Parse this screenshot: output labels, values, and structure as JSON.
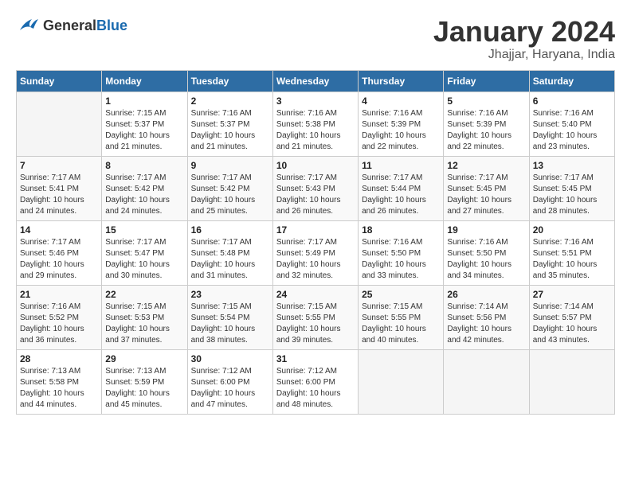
{
  "header": {
    "logo_general": "General",
    "logo_blue": "Blue",
    "title": "January 2024",
    "subtitle": "Jhajjar, Haryana, India"
  },
  "days_of_week": [
    "Sunday",
    "Monday",
    "Tuesday",
    "Wednesday",
    "Thursday",
    "Friday",
    "Saturday"
  ],
  "weeks": [
    [
      {
        "day": "",
        "sunrise": "",
        "sunset": "",
        "daylight": ""
      },
      {
        "day": "1",
        "sunrise": "Sunrise: 7:15 AM",
        "sunset": "Sunset: 5:37 PM",
        "daylight": "Daylight: 10 hours and 21 minutes."
      },
      {
        "day": "2",
        "sunrise": "Sunrise: 7:16 AM",
        "sunset": "Sunset: 5:37 PM",
        "daylight": "Daylight: 10 hours and 21 minutes."
      },
      {
        "day": "3",
        "sunrise": "Sunrise: 7:16 AM",
        "sunset": "Sunset: 5:38 PM",
        "daylight": "Daylight: 10 hours and 21 minutes."
      },
      {
        "day": "4",
        "sunrise": "Sunrise: 7:16 AM",
        "sunset": "Sunset: 5:39 PM",
        "daylight": "Daylight: 10 hours and 22 minutes."
      },
      {
        "day": "5",
        "sunrise": "Sunrise: 7:16 AM",
        "sunset": "Sunset: 5:39 PM",
        "daylight": "Daylight: 10 hours and 22 minutes."
      },
      {
        "day": "6",
        "sunrise": "Sunrise: 7:16 AM",
        "sunset": "Sunset: 5:40 PM",
        "daylight": "Daylight: 10 hours and 23 minutes."
      }
    ],
    [
      {
        "day": "7",
        "sunrise": "Sunrise: 7:17 AM",
        "sunset": "Sunset: 5:41 PM",
        "daylight": "Daylight: 10 hours and 24 minutes."
      },
      {
        "day": "8",
        "sunrise": "Sunrise: 7:17 AM",
        "sunset": "Sunset: 5:42 PM",
        "daylight": "Daylight: 10 hours and 24 minutes."
      },
      {
        "day": "9",
        "sunrise": "Sunrise: 7:17 AM",
        "sunset": "Sunset: 5:42 PM",
        "daylight": "Daylight: 10 hours and 25 minutes."
      },
      {
        "day": "10",
        "sunrise": "Sunrise: 7:17 AM",
        "sunset": "Sunset: 5:43 PM",
        "daylight": "Daylight: 10 hours and 26 minutes."
      },
      {
        "day": "11",
        "sunrise": "Sunrise: 7:17 AM",
        "sunset": "Sunset: 5:44 PM",
        "daylight": "Daylight: 10 hours and 26 minutes."
      },
      {
        "day": "12",
        "sunrise": "Sunrise: 7:17 AM",
        "sunset": "Sunset: 5:45 PM",
        "daylight": "Daylight: 10 hours and 27 minutes."
      },
      {
        "day": "13",
        "sunrise": "Sunrise: 7:17 AM",
        "sunset": "Sunset: 5:45 PM",
        "daylight": "Daylight: 10 hours and 28 minutes."
      }
    ],
    [
      {
        "day": "14",
        "sunrise": "Sunrise: 7:17 AM",
        "sunset": "Sunset: 5:46 PM",
        "daylight": "Daylight: 10 hours and 29 minutes."
      },
      {
        "day": "15",
        "sunrise": "Sunrise: 7:17 AM",
        "sunset": "Sunset: 5:47 PM",
        "daylight": "Daylight: 10 hours and 30 minutes."
      },
      {
        "day": "16",
        "sunrise": "Sunrise: 7:17 AM",
        "sunset": "Sunset: 5:48 PM",
        "daylight": "Daylight: 10 hours and 31 minutes."
      },
      {
        "day": "17",
        "sunrise": "Sunrise: 7:17 AM",
        "sunset": "Sunset: 5:49 PM",
        "daylight": "Daylight: 10 hours and 32 minutes."
      },
      {
        "day": "18",
        "sunrise": "Sunrise: 7:16 AM",
        "sunset": "Sunset: 5:50 PM",
        "daylight": "Daylight: 10 hours and 33 minutes."
      },
      {
        "day": "19",
        "sunrise": "Sunrise: 7:16 AM",
        "sunset": "Sunset: 5:50 PM",
        "daylight": "Daylight: 10 hours and 34 minutes."
      },
      {
        "day": "20",
        "sunrise": "Sunrise: 7:16 AM",
        "sunset": "Sunset: 5:51 PM",
        "daylight": "Daylight: 10 hours and 35 minutes."
      }
    ],
    [
      {
        "day": "21",
        "sunrise": "Sunrise: 7:16 AM",
        "sunset": "Sunset: 5:52 PM",
        "daylight": "Daylight: 10 hours and 36 minutes."
      },
      {
        "day": "22",
        "sunrise": "Sunrise: 7:15 AM",
        "sunset": "Sunset: 5:53 PM",
        "daylight": "Daylight: 10 hours and 37 minutes."
      },
      {
        "day": "23",
        "sunrise": "Sunrise: 7:15 AM",
        "sunset": "Sunset: 5:54 PM",
        "daylight": "Daylight: 10 hours and 38 minutes."
      },
      {
        "day": "24",
        "sunrise": "Sunrise: 7:15 AM",
        "sunset": "Sunset: 5:55 PM",
        "daylight": "Daylight: 10 hours and 39 minutes."
      },
      {
        "day": "25",
        "sunrise": "Sunrise: 7:15 AM",
        "sunset": "Sunset: 5:55 PM",
        "daylight": "Daylight: 10 hours and 40 minutes."
      },
      {
        "day": "26",
        "sunrise": "Sunrise: 7:14 AM",
        "sunset": "Sunset: 5:56 PM",
        "daylight": "Daylight: 10 hours and 42 minutes."
      },
      {
        "day": "27",
        "sunrise": "Sunrise: 7:14 AM",
        "sunset": "Sunset: 5:57 PM",
        "daylight": "Daylight: 10 hours and 43 minutes."
      }
    ],
    [
      {
        "day": "28",
        "sunrise": "Sunrise: 7:13 AM",
        "sunset": "Sunset: 5:58 PM",
        "daylight": "Daylight: 10 hours and 44 minutes."
      },
      {
        "day": "29",
        "sunrise": "Sunrise: 7:13 AM",
        "sunset": "Sunset: 5:59 PM",
        "daylight": "Daylight: 10 hours and 45 minutes."
      },
      {
        "day": "30",
        "sunrise": "Sunrise: 7:12 AM",
        "sunset": "Sunset: 6:00 PM",
        "daylight": "Daylight: 10 hours and 47 minutes."
      },
      {
        "day": "31",
        "sunrise": "Sunrise: 7:12 AM",
        "sunset": "Sunset: 6:00 PM",
        "daylight": "Daylight: 10 hours and 48 minutes."
      },
      {
        "day": "",
        "sunrise": "",
        "sunset": "",
        "daylight": ""
      },
      {
        "day": "",
        "sunrise": "",
        "sunset": "",
        "daylight": ""
      },
      {
        "day": "",
        "sunrise": "",
        "sunset": "",
        "daylight": ""
      }
    ]
  ]
}
